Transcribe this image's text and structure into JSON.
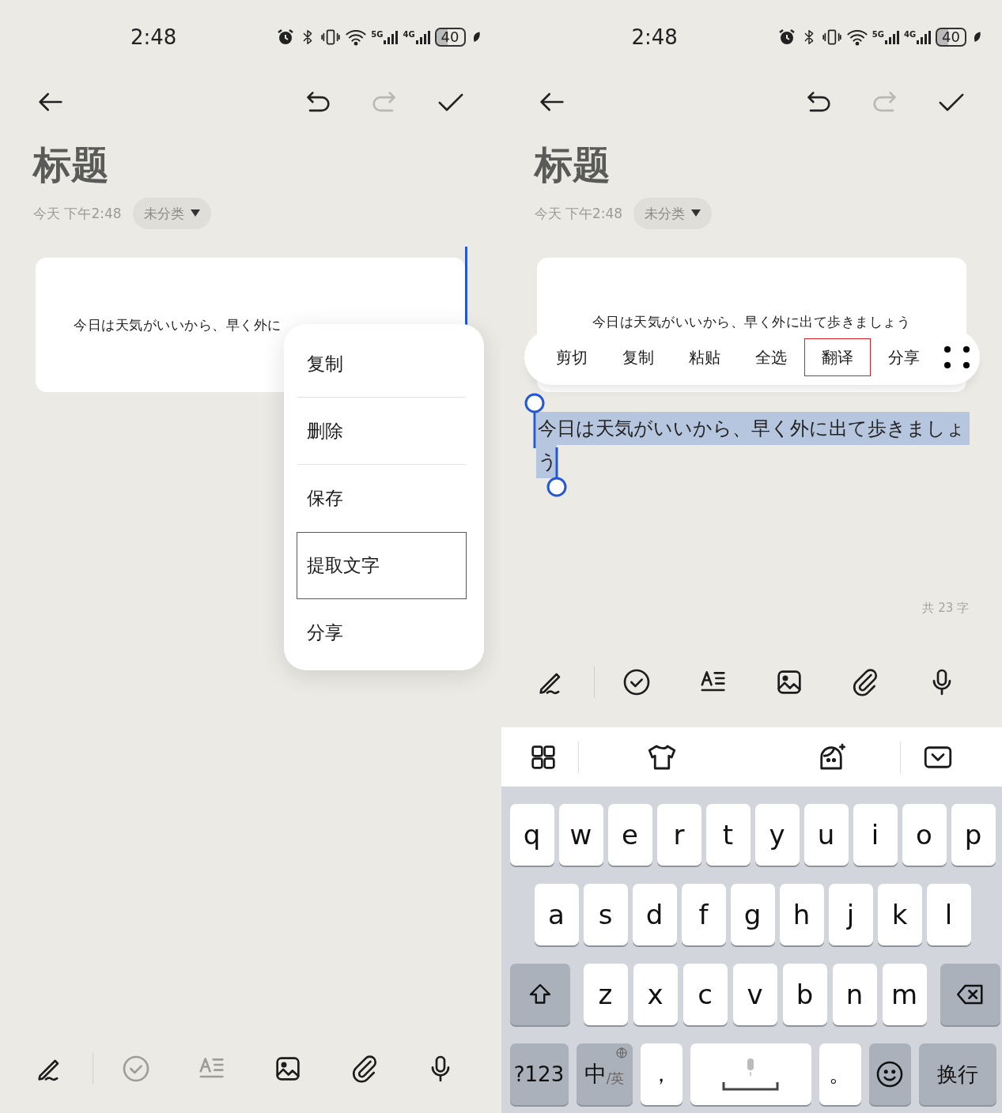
{
  "screens": [
    {
      "status_bar": {
        "time": "2:48",
        "network": [
          "5G",
          "4G"
        ],
        "battery": "40"
      },
      "header_actions": [
        {
          "kind": "undo",
          "disabled": false
        },
        {
          "kind": "redo",
          "disabled": true
        },
        {
          "kind": "done",
          "disabled": false
        }
      ],
      "title": "标题",
      "date": "今天 下午2:48",
      "category": "未分类",
      "image_text": "今日は天気がいいから、早く外に",
      "context_menu": [
        {
          "label": "复制",
          "selected": false,
          "divider_after": true
        },
        {
          "label": "删除",
          "selected": false,
          "divider_after": true
        },
        {
          "label": "保存",
          "selected": false,
          "divider_after": false
        },
        {
          "label": "提取文字",
          "selected": true,
          "divider_after": false
        },
        {
          "label": "分享",
          "selected": false,
          "divider_after": false
        }
      ],
      "tools": [
        {
          "kind": "handwriting",
          "disabled": false
        },
        {
          "kind": "checklist",
          "disabled": true
        },
        {
          "kind": "text_format",
          "disabled": true
        },
        {
          "kind": "image",
          "disabled": false
        },
        {
          "kind": "attachment",
          "disabled": false
        },
        {
          "kind": "voice",
          "disabled": false
        }
      ]
    },
    {
      "status_bar": {
        "time": "2:48",
        "network": [
          "5G",
          "4G"
        ],
        "battery": "40"
      },
      "header_actions": [
        {
          "kind": "undo",
          "disabled": false
        },
        {
          "kind": "redo",
          "disabled": true
        },
        {
          "kind": "done",
          "disabled": false
        }
      ],
      "title": "标题",
      "date": "今天 下午2:48",
      "category": "未分类",
      "image_text": "今日は天気がいいから、早く外に出て歩きましょう",
      "selection_menu": [
        {
          "label": "剪切",
          "selected": false
        },
        {
          "label": "复制",
          "selected": false
        },
        {
          "label": "粘贴",
          "selected": false
        },
        {
          "label": "全选",
          "selected": false
        },
        {
          "label": "翻译",
          "selected": true
        },
        {
          "label": "分享",
          "selected": false
        }
      ],
      "selected_text": "今日は天気がいいから、早く外に出て歩きましょう",
      "word_count": "共 23 字",
      "tools": [
        {
          "kind": "handwriting",
          "disabled": false
        },
        {
          "kind": "checklist",
          "disabled": false
        },
        {
          "kind": "text_format",
          "disabled": false
        },
        {
          "kind": "image",
          "disabled": false
        },
        {
          "kind": "attachment",
          "disabled": false
        },
        {
          "kind": "voice",
          "disabled": false
        }
      ],
      "keyboard": {
        "key_rows": [
          {
            "keys": [
              {
                "kind": "letter",
                "label": "q"
              },
              {
                "kind": "letter",
                "label": "w"
              },
              {
                "kind": "letter",
                "label": "e"
              },
              {
                "kind": "letter",
                "label": "r"
              },
              {
                "kind": "letter",
                "label": "t"
              },
              {
                "kind": "letter",
                "label": "y"
              },
              {
                "kind": "letter",
                "label": "u"
              },
              {
                "kind": "letter",
                "label": "i"
              },
              {
                "kind": "letter",
                "label": "o"
              },
              {
                "kind": "letter",
                "label": "p"
              }
            ]
          },
          {
            "keys": [
              {
                "kind": "letter",
                "label": "a"
              },
              {
                "kind": "letter",
                "label": "s"
              },
              {
                "kind": "letter",
                "label": "d"
              },
              {
                "kind": "letter",
                "label": "f"
              },
              {
                "kind": "letter",
                "label": "g"
              },
              {
                "kind": "letter",
                "label": "h"
              },
              {
                "kind": "letter",
                "label": "j"
              },
              {
                "kind": "letter",
                "label": "k"
              },
              {
                "kind": "letter",
                "label": "l"
              }
            ]
          },
          {
            "keys": [
              {
                "kind": "shift"
              },
              {
                "kind": "letter",
                "label": "z"
              },
              {
                "kind": "letter",
                "label": "x"
              },
              {
                "kind": "letter",
                "label": "c"
              },
              {
                "kind": "letter",
                "label": "v"
              },
              {
                "kind": "letter",
                "label": "b"
              },
              {
                "kind": "letter",
                "label": "n"
              },
              {
                "kind": "letter",
                "label": "m"
              },
              {
                "kind": "backspace"
              }
            ]
          },
          {
            "keys": [
              {
                "kind": "symbols",
                "label": "?123"
              },
              {
                "kind": "lang",
                "label": "中",
                "sub": "/英"
              },
              {
                "kind": "punct",
                "label": "，"
              },
              {
                "kind": "space"
              },
              {
                "kind": "punct",
                "label": "。"
              },
              {
                "kind": "emoji"
              },
              {
                "kind": "enter",
                "label": "换行"
              }
            ]
          }
        ]
      }
    }
  ]
}
